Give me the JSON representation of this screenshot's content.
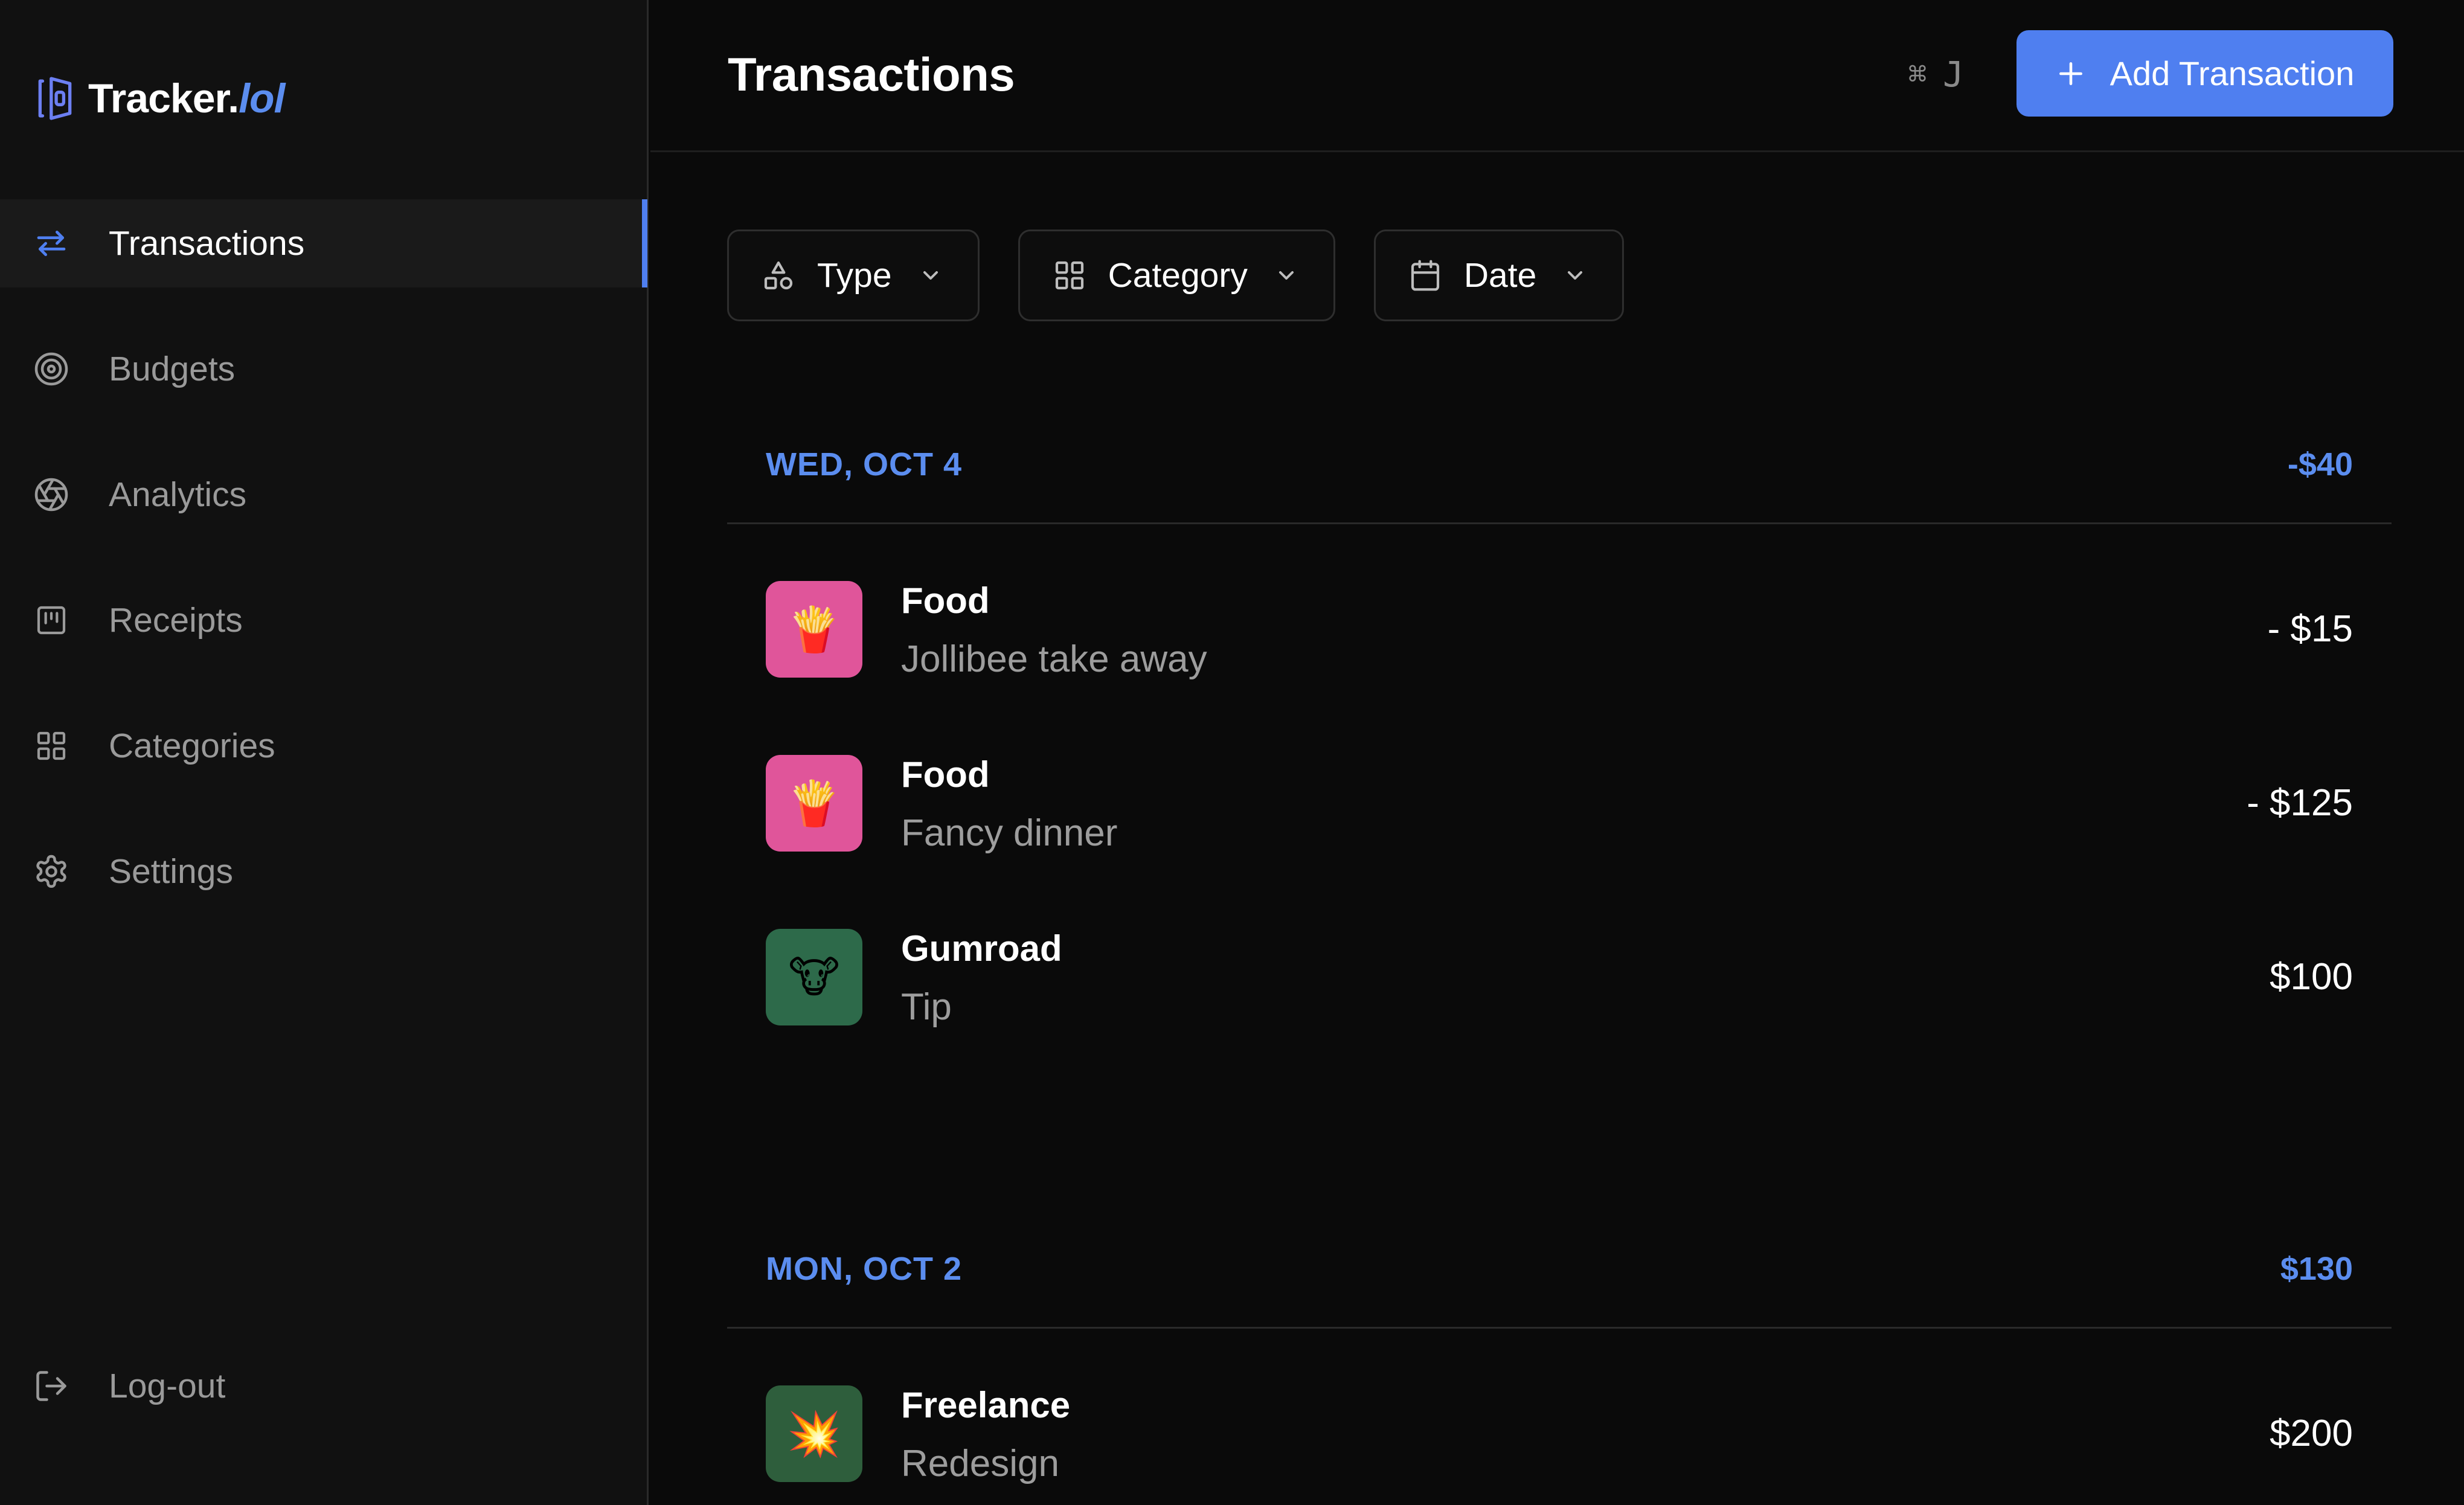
{
  "brand": {
    "name": "Tracker.",
    "accent": "lol"
  },
  "sidebar": {
    "items": [
      {
        "label": "Transactions",
        "icon": "arrows-swap-icon",
        "active": true
      },
      {
        "label": "Budgets",
        "icon": "target-icon",
        "active": false
      },
      {
        "label": "Analytics",
        "icon": "aperture-icon",
        "active": false
      },
      {
        "label": "Receipts",
        "icon": "receipt-icon",
        "active": false
      },
      {
        "label": "Categories",
        "icon": "grid-icon",
        "active": false
      },
      {
        "label": "Settings",
        "icon": "gear-icon",
        "active": false
      }
    ],
    "logout": {
      "label": "Log-out",
      "icon": "logout-icon"
    }
  },
  "header": {
    "title": "Transactions",
    "shortcut": {
      "modifier": "⌘",
      "key": "J"
    },
    "add_button": "Add Transaction"
  },
  "filters": [
    {
      "label": "Type",
      "icon": "shapes-icon"
    },
    {
      "label": "Category",
      "icon": "grid-icon"
    },
    {
      "label": "Date",
      "icon": "calendar-icon"
    }
  ],
  "groups": [
    {
      "date": "WED, OCT 4",
      "total": "-$40",
      "transactions": [
        {
          "title": "Food",
          "desc": "Jollibee take away",
          "amount": "- $15",
          "emoji": "🍟",
          "color": "#e0559a"
        },
        {
          "title": "Food",
          "desc": "Fancy dinner",
          "amount": "- $125",
          "emoji": "🍟",
          "color": "#e0559a"
        },
        {
          "title": "Gumroad",
          "desc": "Tip",
          "amount": "$100",
          "emoji": "🐮",
          "color": "#2d6a4a"
        }
      ]
    },
    {
      "date": "MON, OCT 2",
      "total": "$130",
      "transactions": [
        {
          "title": "Freelance",
          "desc": "Redesign",
          "amount": "$200",
          "emoji": "💥",
          "color": "#2e5e3c"
        }
      ]
    }
  ],
  "colors": {
    "accent": "#4f7ff0",
    "accent_text": "#5b8def",
    "background": "#0a0a0a",
    "sidebar": "#111111"
  }
}
